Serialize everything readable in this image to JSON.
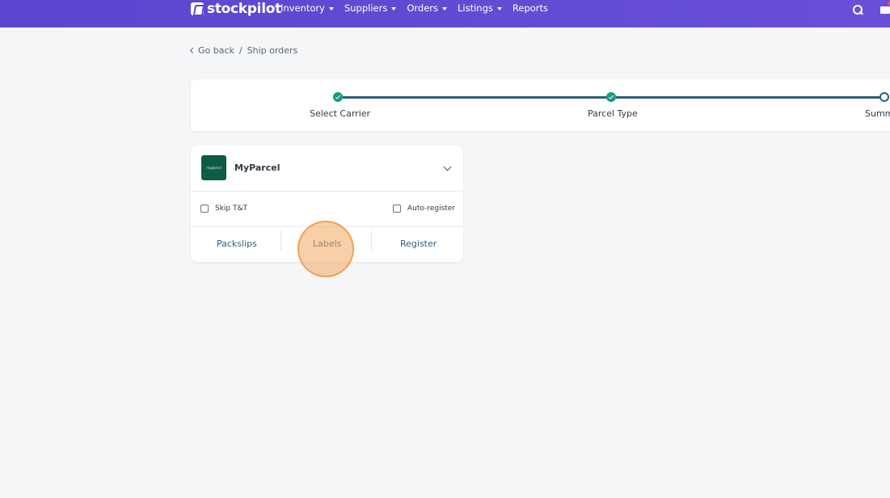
{
  "brand": {
    "name": "stockpilot"
  },
  "nav": {
    "items": [
      {
        "label": "Inventory",
        "dropdown": true
      },
      {
        "label": "Suppliers",
        "dropdown": true
      },
      {
        "label": "Orders",
        "dropdown": true
      },
      {
        "label": "Listings",
        "dropdown": true
      },
      {
        "label": "Reports",
        "dropdown": false
      }
    ]
  },
  "breadcrumb": {
    "back": "Go back",
    "separator": "/",
    "current": "Ship orders"
  },
  "stepper": {
    "steps": [
      {
        "label": "Select Carrier",
        "status": "done"
      },
      {
        "label": "Parcel Type",
        "status": "done"
      },
      {
        "label": "Summ",
        "status": "current"
      }
    ]
  },
  "carrier": {
    "logo_text": "myparcel",
    "name": "MyParcel",
    "options": {
      "skip_tt": "Skip T&T",
      "auto_register": "Auto-register"
    },
    "actions": {
      "packslips": "Packslips",
      "labels": "Labels",
      "register": "Register"
    }
  },
  "colors": {
    "topbar": "#5a46cf",
    "accent": "#2e5f7f",
    "step_done": "#149a83",
    "carrier_brand": "#0e5c45",
    "click_highlight": "#f4a860"
  }
}
